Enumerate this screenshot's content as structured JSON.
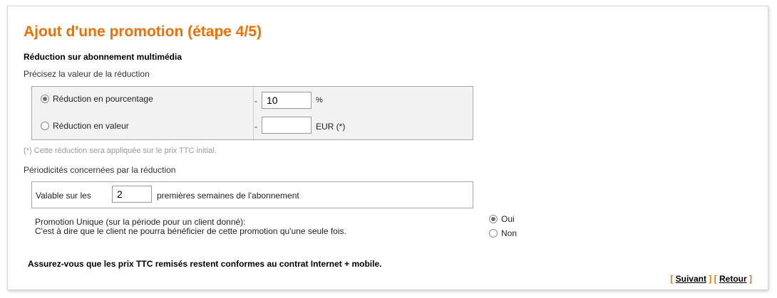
{
  "page": {
    "title": "Ajout d'une promotion (étape 4/5)",
    "subtitle": "Réduction sur abonnement multimédia",
    "accent_color": "#f16e00"
  },
  "reduction": {
    "heading": "Précisez la valeur de la réduction",
    "options": [
      {
        "label": "Réduction en pourcentage",
        "checked": true,
        "prefix": "-",
        "value": "10",
        "unit": "%"
      },
      {
        "label": "Réduction en valeur",
        "checked": false,
        "prefix": "-",
        "value": "",
        "unit": "EUR (*)"
      }
    ],
    "footnote": "(*) Cette réduction sera appliquée sur le prix TTC initial."
  },
  "periodicity": {
    "heading": "Périodicités concernées par la réduction",
    "prefix": "Valable sur les",
    "value": "2",
    "suffix": "premières semaines de l'abonnement"
  },
  "unique": {
    "line1": "Promotion Unique (sur la période pour un client donné):",
    "line2": "C'est à dire que le client ne pourra bénéficier de cette promotion qu'une seule fois.",
    "options": [
      {
        "label": "Oui",
        "checked": true
      },
      {
        "label": "Non",
        "checked": false
      }
    ]
  },
  "warning": "Assurez-vous que les prix TTC remisés restent conformes au contrat Internet + mobile.",
  "nav": {
    "bracket_open": "[",
    "bracket_close": "]",
    "next": "Suivant",
    "back": "Retour"
  }
}
